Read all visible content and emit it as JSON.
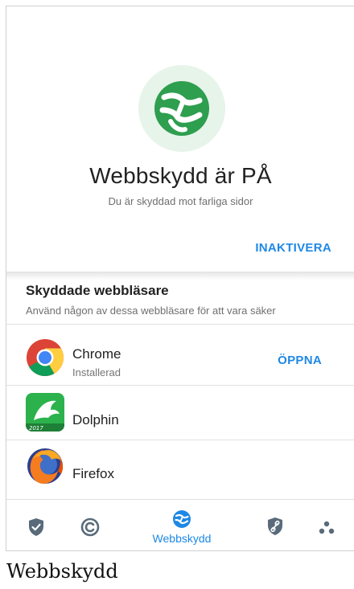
{
  "hero": {
    "icon": "web-shield-logo-icon",
    "title": "Webbskydd är PÅ",
    "subtitle": "Du är skyddad mot farliga sidor",
    "deactivate_label": "INAKTIVERA",
    "accent_color": "#2e9e4f"
  },
  "browsers": {
    "title": "Skyddade webbläsare",
    "subtitle": "Använd någon av dessa webbläsare för att vara säker",
    "items": [
      {
        "name": "Chrome",
        "status": "Installerad",
        "action": "ÖPPNA",
        "icon": "chrome-icon"
      },
      {
        "name": "Dolphin",
        "icon": "dolphin-icon"
      },
      {
        "name": "Firefox",
        "icon": "firefox-icon"
      }
    ]
  },
  "bottom_nav": {
    "items": [
      {
        "icon": "shield-check-icon"
      },
      {
        "icon": "anti-theft-icon"
      },
      {
        "icon": "web-protection-icon",
        "label": "Webbskydd",
        "active": true
      },
      {
        "icon": "shield-link-icon"
      },
      {
        "icon": "more-dots-icon"
      }
    ],
    "active_color": "#1e88e5",
    "inactive_color": "#596b7a"
  },
  "caption": "Webbskydd"
}
